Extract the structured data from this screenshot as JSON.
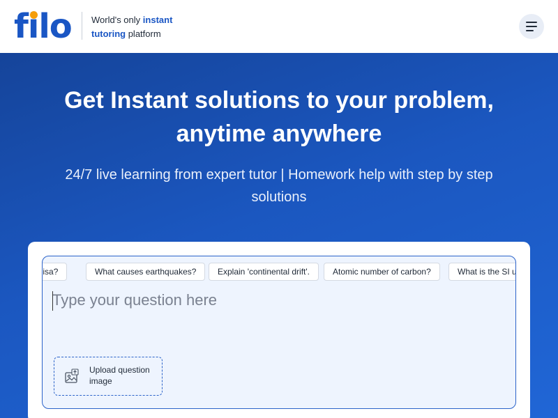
{
  "header": {
    "logo": {
      "text_before": "f",
      "text_i": "i",
      "text_after": "lo"
    },
    "tagline": {
      "part1": "World's only ",
      "highlight1": "instant",
      "highlight2": "tutoring",
      "part2": " platform"
    },
    "menu_icon": "hamburger-menu-icon"
  },
  "hero": {
    "title": "Get Instant solutions to your problem, anytime anywhere",
    "subtitle": "24/7 live learning from expert tutor | Homework help with step by step solutions"
  },
  "question_box": {
    "chips": [
      "na Lisa?",
      "What causes earthquakes?",
      "Explain 'continental drift'.",
      "Atomic number of carbon?",
      "What is the SI unit"
    ],
    "placeholder": "Type your question here",
    "upload": {
      "label": "Upload question image",
      "icon": "image-upload-icon"
    }
  },
  "colors": {
    "brand_blue": "#1a56c4",
    "logo_dot": "#f59e0b",
    "hero_gradient_start": "#15449a",
    "hero_gradient_end": "#2066d6",
    "input_bg": "#eef4fe"
  }
}
